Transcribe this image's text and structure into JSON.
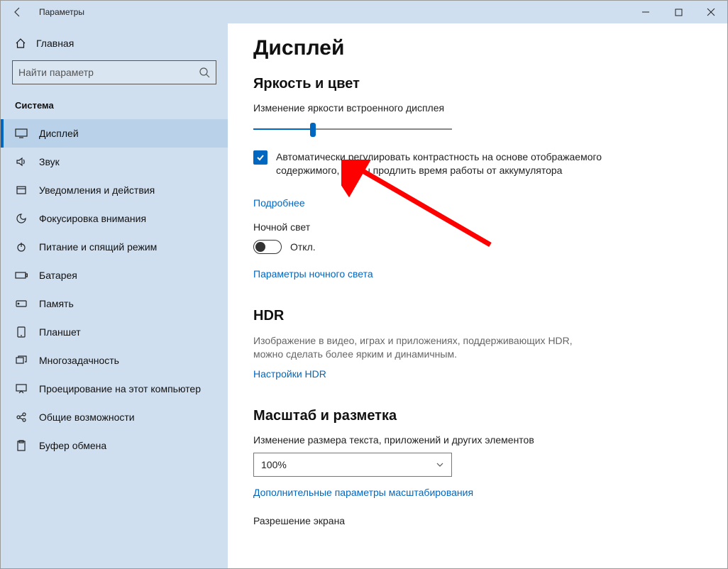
{
  "window": {
    "title": "Параметры"
  },
  "home_label": "Главная",
  "search": {
    "placeholder": "Найти параметр"
  },
  "category": "Система",
  "sidebar": {
    "items": [
      {
        "label": "Дисплей"
      },
      {
        "label": "Звук"
      },
      {
        "label": "Уведомления и действия"
      },
      {
        "label": "Фокусировка внимания"
      },
      {
        "label": "Питание и спящий режим"
      },
      {
        "label": "Батарея"
      },
      {
        "label": "Память"
      },
      {
        "label": "Планшет"
      },
      {
        "label": "Многозадачность"
      },
      {
        "label": "Проецирование на этот компьютер"
      },
      {
        "label": "Общие возможности"
      },
      {
        "label": "Буфер обмена"
      }
    ]
  },
  "page": {
    "title": "Дисплей",
    "brightness_section": "Яркость и цвет",
    "brightness_label": "Изменение яркости встроенного дисплея",
    "brightness_value_percent": 30,
    "auto_contrast_checked": true,
    "auto_contrast_label": "Автоматически регулировать контрастность на основе отображаемого содержимого, чтобы продлить время работы от аккумулятора",
    "more_link": "Подробнее",
    "night_light_label": "Ночной свет",
    "night_light_state": "Откл.",
    "night_light_on": false,
    "night_light_settings_link": "Параметры ночного света",
    "hdr_heading": "HDR",
    "hdr_desc": "Изображение в видео, играх и приложениях, поддерживающих HDR, можно сделать более ярким и динамичным.",
    "hdr_link": "Настройки HDR",
    "scale_heading": "Масштаб и разметка",
    "scale_label": "Изменение размера текста, приложений и других элементов",
    "scale_value": "100%",
    "scale_advanced_link": "Дополнительные параметры масштабирования",
    "resolution_label": "Разрешение экрана"
  }
}
